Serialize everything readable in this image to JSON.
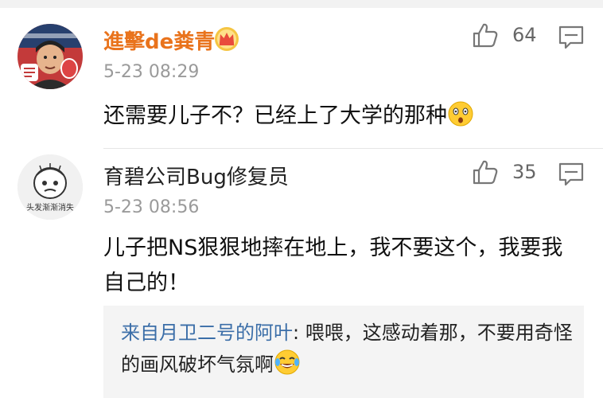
{
  "comments": [
    {
      "username": "進擊de粪青",
      "avatar_icon": "cartoon-portrait-avatar",
      "vip_icon": "crown-badge-icon",
      "timestamp": "5-23 08:29",
      "likes": "64",
      "text": "还需要儿子不？已经上了大学的那种",
      "emoji_icon": "shocked-face-emoji"
    },
    {
      "username": "育碧公司Bug修复员",
      "avatar_icon": "hair-loss-meme-avatar",
      "avatar_caption": "头发渐渐消失",
      "timestamp": "5-23 08:56",
      "likes": "35",
      "text": "儿子把NS狠狠地摔在地上，我不要这个，我要我自己的！",
      "reply": {
        "author": "来自月卫二号的阿叶",
        "separator": ": ",
        "text": "喂喂，这感动着那，不要用奇怪的画风破坏气氛啊",
        "emoji_icon": "laughing-tears-emoji"
      }
    }
  ],
  "colors": {
    "username_highlight": "#e9731c",
    "reply_author": "#3b6ea8",
    "timestamp": "#9a9a9a",
    "reply_background": "#f4f4f4"
  }
}
